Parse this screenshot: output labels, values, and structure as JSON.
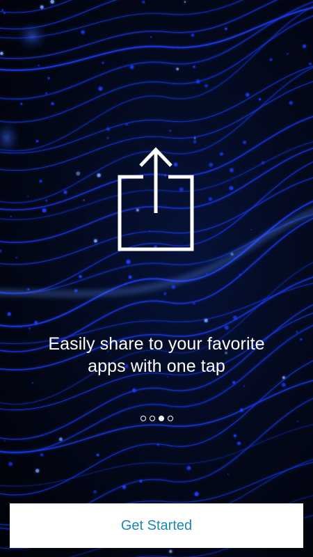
{
  "onboarding": {
    "tagline_line1": "Easily share to your favorite",
    "tagline_line2": "apps with one tap",
    "page_count": 4,
    "current_page": 3,
    "page_labels": [
      "Page 1",
      "Page 2",
      "Page 3",
      "Page 4"
    ],
    "hero_icon": "share-icon",
    "get_started_label": "Get Started"
  },
  "theme": {
    "background": "#02040c",
    "wave_color": "#1c3cff",
    "text_color": "#ffffff",
    "button_background": "#ffffff",
    "button_text_color": "#1b87b4"
  }
}
